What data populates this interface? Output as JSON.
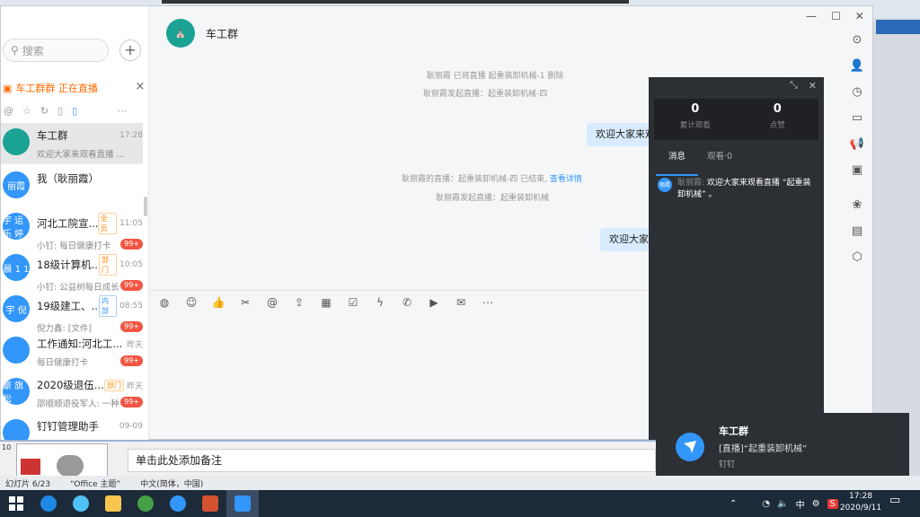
{
  "search": {
    "placeholder": "搜索",
    "add": "+"
  },
  "live_banner": {
    "text": "车工群群 正在直播",
    "close": "×"
  },
  "conversations": [
    {
      "name": "车工群",
      "time": "17:28",
      "preview": "欢迎大家来观看直播 ...",
      "avatar_text": "",
      "avatar_color": "#1aa394",
      "tag": "",
      "badge": ""
    },
    {
      "name": "我（耿丽霞）",
      "time": "",
      "preview": "",
      "avatar_text": "丽霞",
      "avatar_color": "#3296fa",
      "tag": "",
      "badge": ""
    },
    {
      "name": "河北工院宣...",
      "time": "11:05",
      "preview": "小钉: 每日健康打卡",
      "avatar_text": "宇 运 乐 婷",
      "avatar_color": "#3296fa",
      "tag": "全员",
      "badge": "99+"
    },
    {
      "name": "18级计算机...",
      "time": "10:05",
      "preview": "小钉: 公益树每日成长",
      "avatar_text": "晨 1 1",
      "avatar_color": "#3296fa",
      "tag": "部门",
      "badge": "99+"
    },
    {
      "name": "19级建工、...",
      "time": "08:55",
      "preview": "倪力鑫: [文件]",
      "avatar_text": "宇 倪",
      "avatar_color": "#3296fa",
      "tag": "内部",
      "badge": "99+"
    },
    {
      "name": "工作通知:河北工...",
      "time": "昨天",
      "preview": "每日健康打卡",
      "avatar_text": "",
      "avatar_color": "#3296fa",
      "tag": "",
      "badge": "99+"
    },
    {
      "name": "2020级退伍...",
      "time": "昨天",
      "preview": "邵顺顺退役军人: 一种...",
      "avatar_text": "豪 旗 松",
      "avatar_color": "#3296fa",
      "tag": "部门",
      "badge": "99+"
    },
    {
      "name": "钉钉管理助手",
      "time": "09-09",
      "preview": "",
      "avatar_text": "",
      "avatar_color": "#3296fa",
      "tag": "",
      "badge": ""
    }
  ],
  "chat": {
    "title": "车工群",
    "sys1": "耿丽霞 已将直播 起重装卸机械-1 删除",
    "sys2": "耿丽霞发起直播：起重装卸机械-四",
    "bubble1": "欢迎大家来观",
    "sys3": "耿丽霞的直播：起重装卸机械-四 已结束,",
    "sys3_link": "查看详情",
    "sys4": "耿丽霞发起直播：起重装卸机械",
    "bubble2": "欢迎大家3"
  },
  "live_panel": {
    "views": "0",
    "views_label": "累计观看",
    "likes": "0",
    "likes_label": "点赞",
    "tab_msg": "消息",
    "tab_viewers": "观看·0",
    "msg_avatar": "丽霞",
    "msg_author": "耿丽霞:",
    "msg_text": "欢迎大家来观看直播 “起重装卸机械” 。"
  },
  "toast": {
    "title": "车工群",
    "text": "[直播]“起重装卸机械”",
    "app": "钉钉"
  },
  "ppt": {
    "slide_num": "10",
    "notes": "单击此处添加备注",
    "status_slide": "幻灯片 6/23",
    "status_theme": "“Office 主题”",
    "status_lang": "中文(简体，中国)"
  },
  "taskbar": {
    "time": "17:28",
    "date": "2020/9/11",
    "ime": "中"
  }
}
